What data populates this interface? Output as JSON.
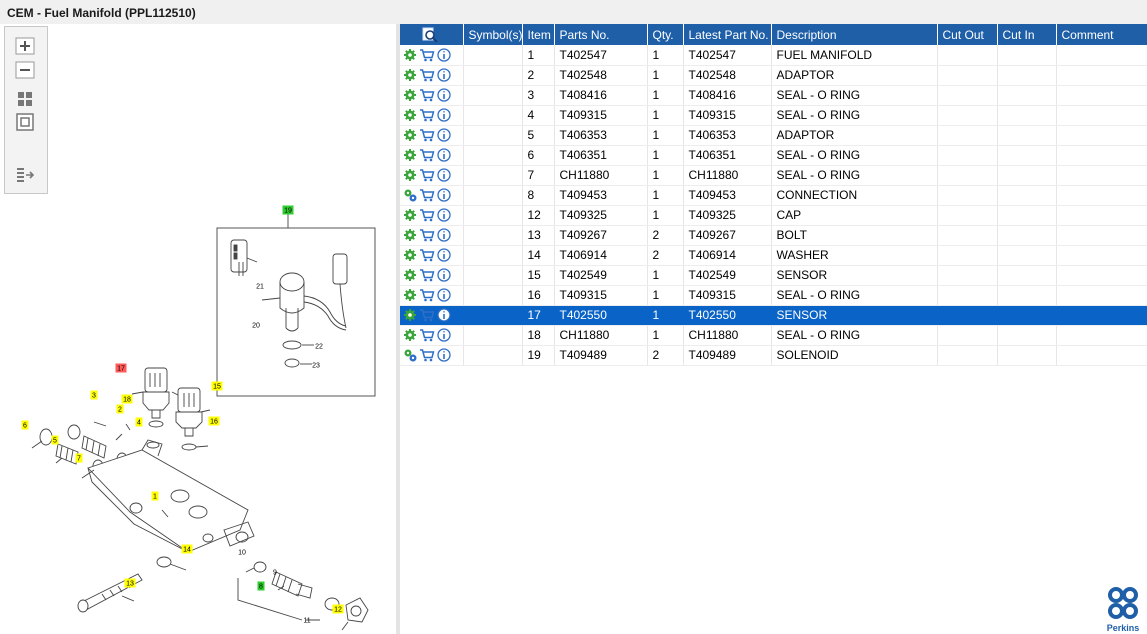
{
  "window": {
    "title": "CEM - Fuel Manifold (PPL112510)"
  },
  "toolbar": {
    "buttons": [
      {
        "name": "zoom-in-button",
        "icon": "plus-icon"
      },
      {
        "name": "zoom-out-button",
        "icon": "minus-icon"
      },
      {
        "name": "fit-all-button",
        "icon": "grid-icon"
      },
      {
        "name": "actual-size-button",
        "icon": "square-icon"
      },
      {
        "name": "export-button",
        "icon": "list-arrow-icon"
      }
    ]
  },
  "diagram": {
    "callouts": [
      {
        "label": "19",
        "color": "green"
      },
      {
        "label": "21",
        "color": "none"
      },
      {
        "label": "20",
        "color": "none"
      },
      {
        "label": "22",
        "color": "none"
      },
      {
        "label": "23",
        "color": "none"
      },
      {
        "label": "17",
        "color": "red"
      },
      {
        "label": "15",
        "color": "yellow"
      },
      {
        "label": "3",
        "color": "yellow"
      },
      {
        "label": "18",
        "color": "yellow"
      },
      {
        "label": "2",
        "color": "yellow"
      },
      {
        "label": "16",
        "color": "yellow"
      },
      {
        "label": "4",
        "color": "yellow"
      },
      {
        "label": "6",
        "color": "yellow"
      },
      {
        "label": "5",
        "color": "yellow"
      },
      {
        "label": "7",
        "color": "yellow"
      },
      {
        "label": "1",
        "color": "yellow"
      },
      {
        "label": "14",
        "color": "yellow"
      },
      {
        "label": "10",
        "color": "none"
      },
      {
        "label": "9",
        "color": "none"
      },
      {
        "label": "13",
        "color": "yellow"
      },
      {
        "label": "8",
        "color": "green"
      },
      {
        "label": "11",
        "color": "none"
      },
      {
        "label": "12",
        "color": "yellow"
      }
    ]
  },
  "table": {
    "columns": [
      "",
      "Symbol(s)",
      "Item",
      "Parts No.",
      "Qty.",
      "Latest Part No.",
      "Description",
      "Cut Out",
      "Cut In",
      "Comment"
    ],
    "header_icon": "magnifier-icon",
    "row_icons": [
      "gear-icon",
      "cart-icon",
      "info-icon"
    ],
    "rows": [
      {
        "item": "1",
        "part": "T402547",
        "qty": "1",
        "latest": "T402547",
        "desc": "FUEL MANIFOLD",
        "gear": "single",
        "selected": false
      },
      {
        "item": "2",
        "part": "T402548",
        "qty": "1",
        "latest": "T402548",
        "desc": "ADAPTOR",
        "gear": "single",
        "selected": false
      },
      {
        "item": "3",
        "part": "T408416",
        "qty": "1",
        "latest": "T408416",
        "desc": "SEAL - O RING",
        "gear": "single",
        "selected": false
      },
      {
        "item": "4",
        "part": "T409315",
        "qty": "1",
        "latest": "T409315",
        "desc": "SEAL - O RING",
        "gear": "single",
        "selected": false
      },
      {
        "item": "5",
        "part": "T406353",
        "qty": "1",
        "latest": "T406353",
        "desc": "ADAPTOR",
        "gear": "single",
        "selected": false
      },
      {
        "item": "6",
        "part": "T406351",
        "qty": "1",
        "latest": "T406351",
        "desc": "SEAL - O RING",
        "gear": "single",
        "selected": false
      },
      {
        "item": "7",
        "part": "CH11880",
        "qty": "1",
        "latest": "CH11880",
        "desc": "SEAL - O RING",
        "gear": "single",
        "selected": false
      },
      {
        "item": "8",
        "part": "T409453",
        "qty": "1",
        "latest": "T409453",
        "desc": "CONNECTION",
        "gear": "multi",
        "selected": false
      },
      {
        "item": "12",
        "part": "T409325",
        "qty": "1",
        "latest": "T409325",
        "desc": "CAP",
        "gear": "single",
        "selected": false
      },
      {
        "item": "13",
        "part": "T409267",
        "qty": "2",
        "latest": "T409267",
        "desc": "BOLT",
        "gear": "single",
        "selected": false
      },
      {
        "item": "14",
        "part": "T406914",
        "qty": "2",
        "latest": "T406914",
        "desc": "WASHER",
        "gear": "single",
        "selected": false
      },
      {
        "item": "15",
        "part": "T402549",
        "qty": "1",
        "latest": "T402549",
        "desc": "SENSOR",
        "gear": "single",
        "selected": false
      },
      {
        "item": "16",
        "part": "T409315",
        "qty": "1",
        "latest": "T409315",
        "desc": "SEAL - O RING",
        "gear": "single",
        "selected": false
      },
      {
        "item": "17",
        "part": "T402550",
        "qty": "1",
        "latest": "T402550",
        "desc": "SENSOR",
        "gear": "single",
        "selected": true
      },
      {
        "item": "18",
        "part": "CH11880",
        "qty": "1",
        "latest": "CH11880",
        "desc": "SEAL - O RING",
        "gear": "single",
        "selected": false
      },
      {
        "item": "19",
        "part": "T409489",
        "qty": "2",
        "latest": "T409489",
        "desc": "SOLENOID",
        "gear": "multi",
        "selected": false
      }
    ]
  },
  "brand": {
    "name": "Perkins",
    "color": "#1f5fa8"
  },
  "colors": {
    "header": "#1f5fa8",
    "selected": "#0a63c6",
    "callout_yellow": "#ffff00",
    "callout_green": "#2ecc2e",
    "callout_red": "#ff5a5a"
  }
}
